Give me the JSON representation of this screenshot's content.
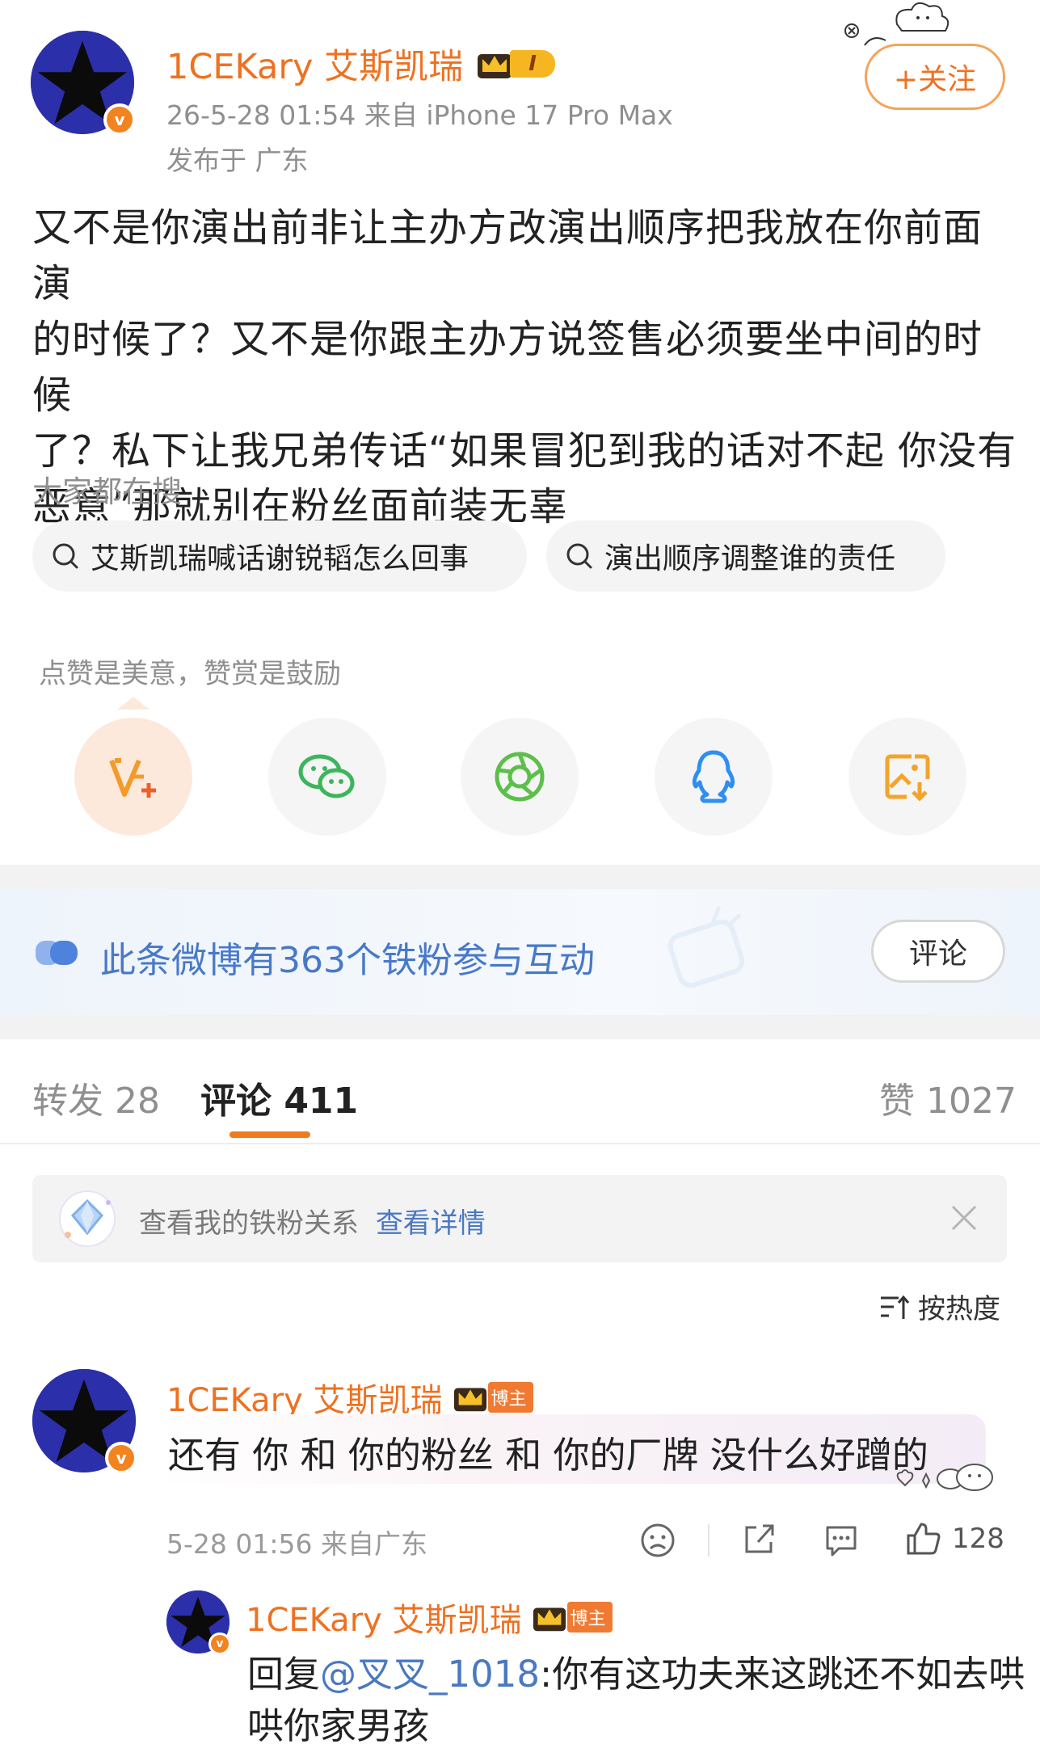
{
  "post": {
    "username": "1CEKary 艾斯凯瑞",
    "level_badge": "I",
    "verified_mark": "v",
    "time_source": "26-5-28 01:54  来自 iPhone 17 Pro Max",
    "location": "发布于 广东",
    "follow_label": "+关注",
    "body_lines": [
      "又不是你演出前非让主办方改演出顺序把我放在你前面演",
      "的时候了？又不是你跟主办方说签售必须要坐中间的时候",
      "了？私下让我兄弟传话“如果冒犯到我的话对不起 你没有",
      "恶意”那就别在粉丝面前装无辜"
    ]
  },
  "trending": {
    "title": "大家都在搜",
    "chips": [
      "艾斯凯瑞喊话谢锐韬怎么回事",
      "演出顺序调整谁的责任"
    ]
  },
  "share": {
    "label": "点赞是美意，赞赏是鼓励",
    "icons": [
      "reward-v-icon",
      "wechat-icon",
      "moments-icon",
      "qq-icon",
      "save-image-icon"
    ]
  },
  "fans_strip": {
    "text": "此条微博有363个铁粉参与互动",
    "button": "评论"
  },
  "tabs": {
    "repost": "转发 28",
    "comment": "评论 411",
    "like": "赞 1027"
  },
  "fan_banner": {
    "text": "查看我的铁粉关系",
    "link": "查看详情"
  },
  "sort": {
    "label": "按热度"
  },
  "comments": [
    {
      "username": "1CEKary 艾斯凯瑞",
      "badge": "博主",
      "text": "还有 你 和 你的粉丝 和 你的厂牌 没什么好蹭的",
      "meta": "5-28 01:56 来自广东",
      "likes": "128"
    }
  ],
  "reply": {
    "username": "1CEKary 艾斯凯瑞",
    "badge": "博主",
    "prefix": "回复",
    "mention": "@叉叉_1018",
    "text_line1": ":你有这功夫来这跳还不如去哄",
    "text_line2": "哄你家男孩"
  },
  "colors": {
    "brand_orange": "#ee7121",
    "link_blue": "#4a78c2",
    "avatar_blue": "#2b2fa9"
  }
}
